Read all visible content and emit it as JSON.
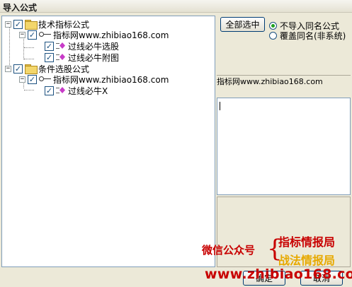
{
  "window": {
    "title": "导入公式"
  },
  "tree": {
    "groups": [
      {
        "label": "技术指标公式",
        "expander": "−",
        "checked": true,
        "source": {
          "label": "指标网www.zhibiao168.com",
          "expander": "−",
          "checked": true,
          "items": [
            {
              "label": "过线必牛选股",
              "checked": true
            },
            {
              "label": "过线必牛附图",
              "checked": true
            }
          ]
        }
      },
      {
        "label": "条件选股公式",
        "expander": "−",
        "checked": true,
        "source": {
          "label": "指标网www.zhibiao168.com",
          "expander": "−",
          "checked": true,
          "items": [
            {
              "label": "过线必牛X",
              "checked": true
            }
          ]
        }
      }
    ]
  },
  "controls": {
    "select_all_label": "全部选中",
    "radio_options": [
      {
        "label": "不导入同名公式",
        "selected": true
      },
      {
        "label": "覆盖同名(非系统)",
        "selected": false
      }
    ]
  },
  "info": {
    "source_text": "指标网www.zhibiao168.com"
  },
  "buttons": {
    "ok_label": "确定",
    "cancel_label": "取消"
  },
  "watermark": {
    "left_text": "微信公众号",
    "brace": "{",
    "right_line1": "指标情报局",
    "right_line2": "战法情报局",
    "url": "www.zhibiao168.com"
  },
  "colors": {
    "accent_red": "#c80000",
    "accent_gold": "#e7a900",
    "radio_dot": "#21a121"
  }
}
